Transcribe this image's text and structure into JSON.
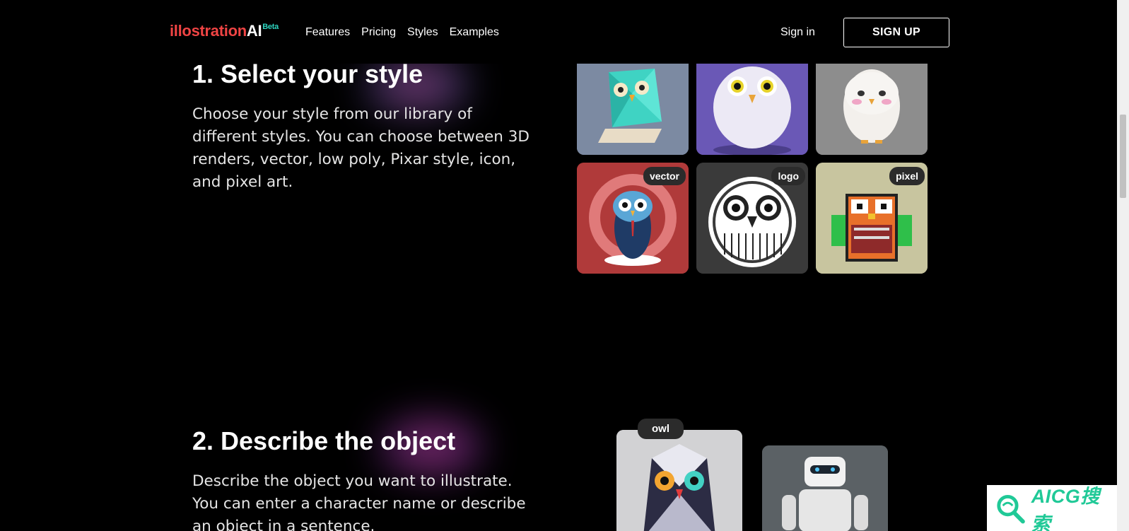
{
  "nav": {
    "logo_part1": "illostration",
    "logo_part2": "AI",
    "logo_badge": "Beta",
    "links": [
      "Features",
      "Pricing",
      "Styles",
      "Examples"
    ],
    "signin": "Sign in",
    "signup": "SIGN UP"
  },
  "section1": {
    "title": "1. Select your style",
    "body": "Choose your style from our library of different styles. You can choose between 3D renders, vector, low poly, Pixar style, icon, and pixel art."
  },
  "section1_tiles": [
    {
      "badge": "",
      "bg": "#7f8ea6"
    },
    {
      "badge": "",
      "bg": "#6d5bb8"
    },
    {
      "badge": "",
      "bg": "#8a8a8a"
    },
    {
      "badge": "vector",
      "bg": "#b23a3a"
    },
    {
      "badge": "logo",
      "bg": "#3a3a3a"
    },
    {
      "badge": "pixel",
      "bg": "#c7c4a0"
    }
  ],
  "section2": {
    "title": "2. Describe the object",
    "body": "Describe the object you want to illustrate. You can enter a character name or describe an object in a sentence."
  },
  "section2_tiles": [
    {
      "badge": "owl"
    },
    {
      "badge": ""
    }
  ],
  "watermark": {
    "text": "AICG搜索"
  },
  "colors": {
    "accent_red": "#ef4444",
    "accent_teal": "#2dd4bf",
    "watermark_green": "#20c997"
  }
}
